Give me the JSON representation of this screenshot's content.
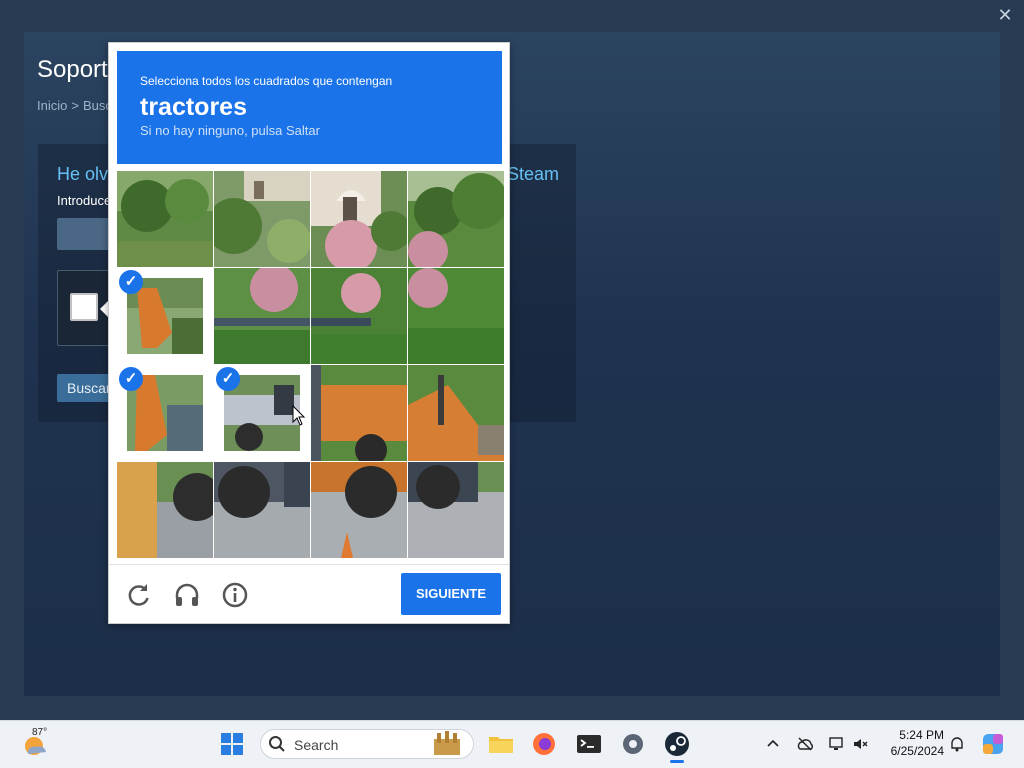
{
  "steam": {
    "page_title": "Soport",
    "breadcrumb_home": "Inicio",
    "breadcrumb_sep": ">",
    "breadcrumb_next": "Busc",
    "heading": "He olv",
    "heading_tail": "Steam",
    "intro": "Introduce",
    "search_button": "Buscar"
  },
  "recaptcha": {
    "instruction": "Selecciona todos los cuadrados que contengan",
    "target": "tractores",
    "hint": "Si no hay ninguno, pulsa Saltar",
    "submit_label": "SIGUIENTE",
    "selected_tiles": [
      4,
      8,
      9
    ],
    "accent_color": "#1a73e8",
    "icons": [
      "reload-icon",
      "audio-icon",
      "info-icon"
    ]
  },
  "taskbar": {
    "weather_temp": "87°",
    "search_label": "Search",
    "time": "5:24 PM",
    "date": "6/25/2024",
    "apps": [
      "file-explorer-icon",
      "firefox-icon",
      "terminal-icon",
      "settings-icon",
      "steam-icon"
    ]
  }
}
